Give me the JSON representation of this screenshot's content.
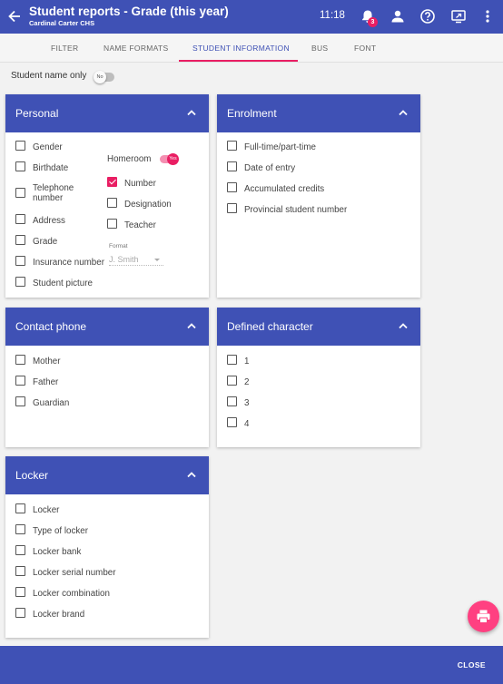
{
  "appbar": {
    "title": "Student reports - Grade (this year)",
    "subtitle": "Cardinal Carter CHS",
    "time": "11:18",
    "notification_count": "3"
  },
  "tabs": [
    "FILTER",
    "NAME FORMATS",
    "STUDENT INFORMATION",
    "BUS",
    "FONT"
  ],
  "active_tab": "STUDENT INFORMATION",
  "student_name_only": {
    "label": "Student name only",
    "toggle": "No"
  },
  "personal": {
    "title": "Personal",
    "items": [
      {
        "label": "Gender",
        "checked": false
      },
      {
        "label": "Birthdate",
        "checked": false
      },
      {
        "label": "Telephone number",
        "checked": false
      },
      {
        "label": "Address",
        "checked": false
      },
      {
        "label": "Grade",
        "checked": false
      },
      {
        "label": "Insurance number",
        "checked": false
      },
      {
        "label": "Student picture",
        "checked": false
      }
    ],
    "homeroom": {
      "label": "Homeroom",
      "toggle": "Yes"
    },
    "homeroom_items": [
      {
        "label": "Number",
        "checked": true
      },
      {
        "label": "Designation",
        "checked": false
      },
      {
        "label": "Teacher",
        "checked": false
      }
    ],
    "format": {
      "label": "Format",
      "value": "J. Smith"
    }
  },
  "enrolment": {
    "title": "Enrolment",
    "items": [
      {
        "label": "Full-time/part-time",
        "checked": false
      },
      {
        "label": "Date of entry",
        "checked": false
      },
      {
        "label": "Accumulated credits",
        "checked": false
      },
      {
        "label": "Provincial student number",
        "checked": false
      }
    ]
  },
  "contact_phone": {
    "title": "Contact phone",
    "items": [
      {
        "label": "Mother",
        "checked": false
      },
      {
        "label": "Father",
        "checked": false
      },
      {
        "label": "Guardian",
        "checked": false
      }
    ]
  },
  "defined_character": {
    "title": "Defined character",
    "items": [
      {
        "label": "1",
        "checked": false
      },
      {
        "label": "2",
        "checked": false
      },
      {
        "label": "3",
        "checked": false
      },
      {
        "label": "4",
        "checked": false
      }
    ]
  },
  "locker": {
    "title": "Locker",
    "items": [
      {
        "label": "Locker",
        "checked": false
      },
      {
        "label": "Type of locker",
        "checked": false
      },
      {
        "label": "Locker bank",
        "checked": false
      },
      {
        "label": "Locker serial number",
        "checked": false
      },
      {
        "label": "Locker combination",
        "checked": false
      },
      {
        "label": "Locker brand",
        "checked": false
      }
    ]
  },
  "footer": {
    "close_label": "CLOSE"
  },
  "colors": {
    "primary": "#3f51b5",
    "accent": "#e91e63",
    "fab": "#ff4081"
  }
}
